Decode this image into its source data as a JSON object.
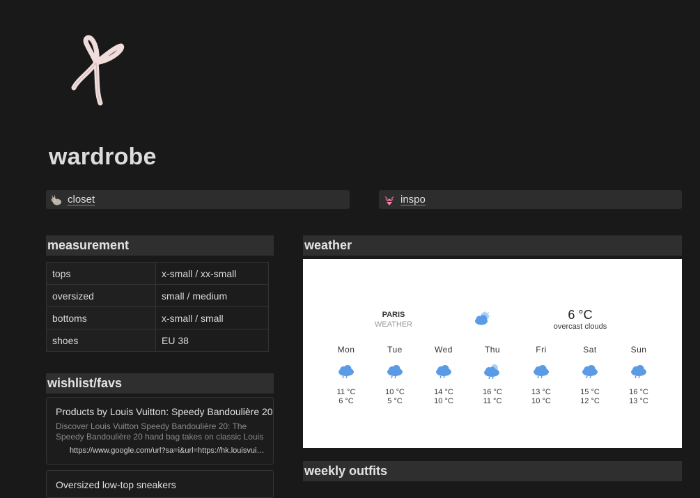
{
  "page": {
    "title": "wardrobe"
  },
  "links": [
    {
      "label": "closet",
      "icon": "rabbit-icon"
    },
    {
      "label": "inspo",
      "icon": "bikini-icon"
    }
  ],
  "measurement": {
    "heading": "measurement",
    "rows": [
      {
        "key": "tops",
        "value": "x-small / xx-small"
      },
      {
        "key": "oversized",
        "value": "small / medium"
      },
      {
        "key": "bottoms",
        "value": "x-small / small"
      },
      {
        "key": "shoes",
        "value": "EU 38"
      }
    ]
  },
  "wishlist": {
    "heading": "wishlist/favs",
    "items": [
      {
        "title": "Products by Louis Vuitton: Speedy Bandoulière 20",
        "description": "Discover Louis Vuitton Speedy Bandoulière 20: The Speedy Bandoulière 20 hand bag takes on classic Louis",
        "url": "https://www.google.com/url?sa=i&url=https://hk.louisvuitton.com"
      },
      {
        "title": "Oversized low-top sneakers"
      }
    ]
  },
  "weather": {
    "heading": "weather",
    "city": "PARIS",
    "sub": "WEATHER",
    "current_temp": "6 °C",
    "current_desc": "overcast clouds",
    "days": [
      {
        "name": "Mon",
        "high": "11 °C",
        "low": "6 °C",
        "icon": "rain-cloud-icon"
      },
      {
        "name": "Tue",
        "high": "10 °C",
        "low": "5 °C",
        "icon": "rain-cloud-icon"
      },
      {
        "name": "Wed",
        "high": "14 °C",
        "low": "10 °C",
        "icon": "rain-cloud-icon"
      },
      {
        "name": "Thu",
        "high": "16 °C",
        "low": "11 °C",
        "icon": "sun-rain-cloud-icon"
      },
      {
        "name": "Fri",
        "high": "13 °C",
        "low": "10 °C",
        "icon": "rain-cloud-icon"
      },
      {
        "name": "Sat",
        "high": "15 °C",
        "low": "12 °C",
        "icon": "rain-cloud-icon"
      },
      {
        "name": "Sun",
        "high": "16 °C",
        "low": "13 °C",
        "icon": "rain-cloud-icon"
      }
    ]
  },
  "weekly_outfits": {
    "heading": "weekly outfits"
  },
  "colors": {
    "background": "#191919",
    "card": "#2d2d2d",
    "weather_icon": "#5b9be6"
  }
}
